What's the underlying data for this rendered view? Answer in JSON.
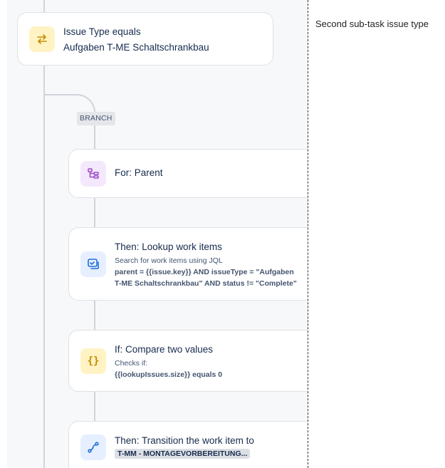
{
  "side_note": "Second sub-task issue type",
  "condition_card": {
    "title": "Issue Type equals",
    "value": "Aufgaben T-ME Schaltschrankbau",
    "icon": "swap-arrows-icon"
  },
  "branch_label": "BRANCH",
  "for_card": {
    "title": "For: Parent",
    "icon": "hierarchy-icon"
  },
  "lookup_card": {
    "title": "Then: Lookup work items",
    "subtitle": "Search for work items using JQL",
    "query_line1": "parent = {{issue.key}} AND issueType = \"Aufgaben",
    "query_line2": "T-ME Schaltschrankbau\" AND status != \"Complete\"",
    "icon": "lookup-icon"
  },
  "compare_card": {
    "title": "If: Compare two values",
    "subtitle": "Checks if:",
    "expression": "{{lookupIssues.size}} equals 0",
    "icon": "curly-braces-icon"
  },
  "transition_card": {
    "title": "Then: Transition the work item to",
    "status": "T-MM - MONTAGEVORBEREITUNG...",
    "icon": "transition-icon"
  },
  "colors": {
    "canvas": "#f7f8f9",
    "connector": "#d0d4da",
    "yellow_icon_bg": "#fff3c4",
    "purple_icon_bg": "#f3e8fc",
    "blue_icon_bg": "#e6efff"
  }
}
